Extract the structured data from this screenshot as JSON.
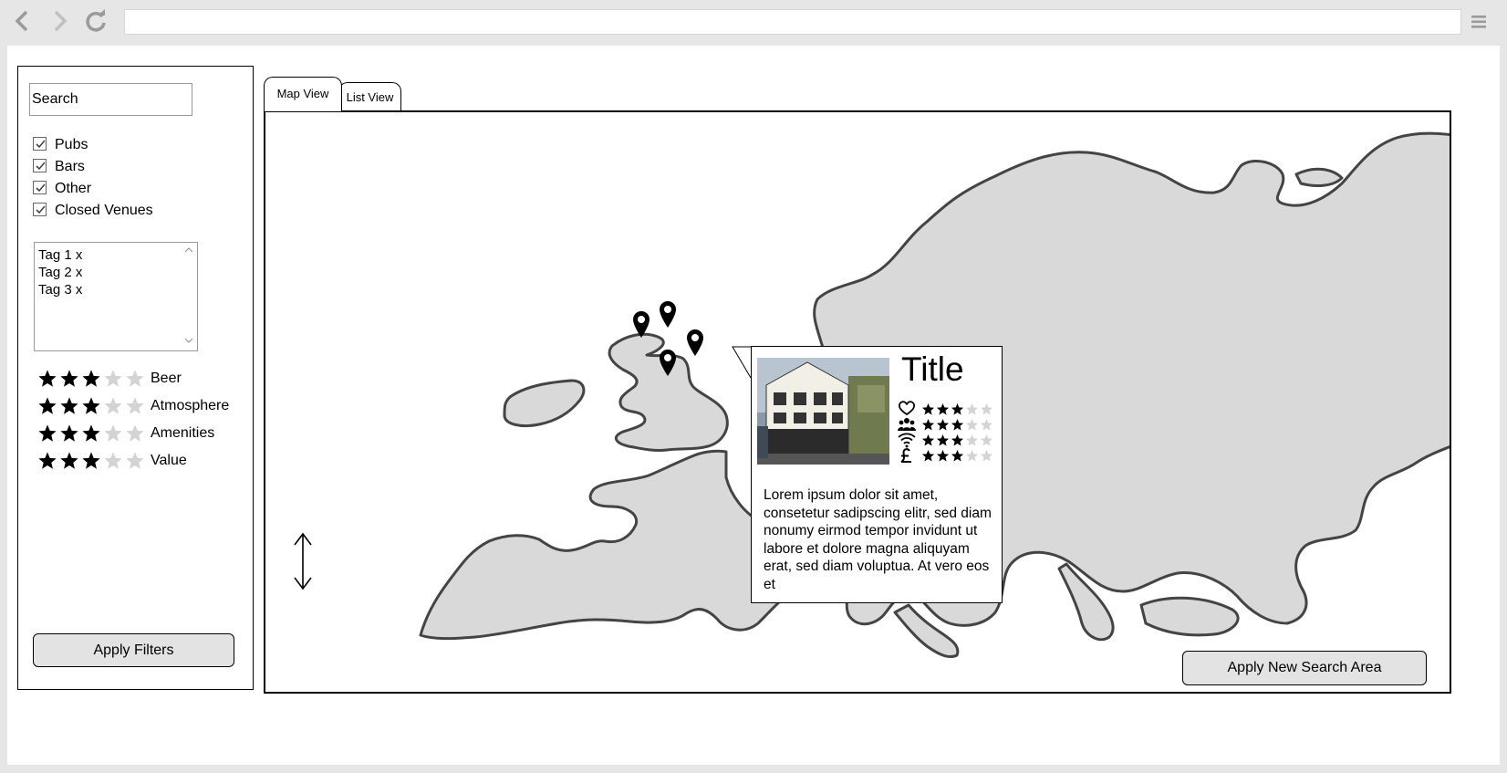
{
  "browser": {
    "back_icon": "chevron-left-icon",
    "forward_icon": "chevron-right-icon",
    "reload_icon": "reload-icon",
    "menu_icon": "hamburger-menu-icon",
    "url": ""
  },
  "sidebar": {
    "search_value": "Search",
    "filters": [
      {
        "label": "Pubs",
        "checked": true
      },
      {
        "label": "Bars",
        "checked": true
      },
      {
        "label": "Other",
        "checked": true
      },
      {
        "label": "Closed Venues",
        "checked": true
      }
    ],
    "tags": [
      "Tag 1 x",
      "Tag 2 x",
      "Tag 3 x"
    ],
    "ratings": [
      {
        "label": "Beer",
        "stars": 3,
        "max": 5
      },
      {
        "label": "Atmosphere",
        "stars": 3,
        "max": 5
      },
      {
        "label": "Amenities",
        "stars": 3,
        "max": 5
      },
      {
        "label": "Value",
        "stars": 3,
        "max": 5
      }
    ],
    "apply_label": "Apply Filters"
  },
  "tabs": [
    {
      "label": "Map View",
      "active": true
    },
    {
      "label": "List View",
      "active": false
    }
  ],
  "map": {
    "apply_area_label": "Apply New Search Area",
    "zoom_icon": "vertical-resize-arrow-icon",
    "pin_icon": "map-pin-icon",
    "land_color": "#d9d9d9"
  },
  "popup": {
    "title": "Title",
    "photo": "venue-photo",
    "ratings": [
      {
        "icon": "heart-icon",
        "stars": 3,
        "max": 5
      },
      {
        "icon": "group-icon",
        "stars": 3,
        "max": 5
      },
      {
        "icon": "wifi-icon",
        "stars": 3,
        "max": 5
      },
      {
        "icon": "pound-icon",
        "stars": 3,
        "max": 5
      }
    ],
    "description": "Lorem ipsum dolor sit amet, consetetur sadipscing elitr, sed diam nonumy eirmod tempor invidunt ut labore et dolore magna aliquyam erat, sed diam voluptua. At vero eos et"
  }
}
